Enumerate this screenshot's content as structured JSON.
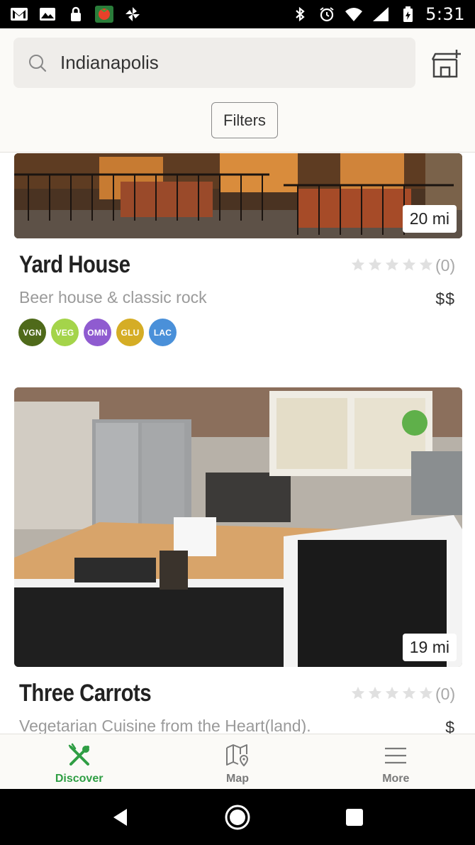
{
  "status_bar": {
    "time": "5:31"
  },
  "search": {
    "value": "Indianapolis",
    "placeholder": ""
  },
  "filters": {
    "label": "Filters"
  },
  "places": [
    {
      "name": "Yard House",
      "tagline": "Beer house & classic rock",
      "distance": "20 mi",
      "rating": 0,
      "review_count": "(0)",
      "price": "$$",
      "badges": [
        {
          "label": "VGN",
          "color": "#4f6a1a"
        },
        {
          "label": "VEG",
          "color": "#a4d44a"
        },
        {
          "label": "OMN",
          "color": "#8f5bd0"
        },
        {
          "label": "GLU",
          "color": "#d5ad25"
        },
        {
          "label": "LAC",
          "color": "#4a90d9"
        }
      ]
    },
    {
      "name": "Three Carrots",
      "tagline": "Vegetarian Cuisine from the Heart(land).",
      "distance": "19 mi",
      "rating": 0,
      "review_count": "(0)",
      "price": "$"
    }
  ],
  "bottom_nav": [
    {
      "label": "Discover",
      "icon": "fork-spoon-icon",
      "active": true
    },
    {
      "label": "Map",
      "icon": "map-pin-icon",
      "active": false
    },
    {
      "label": "More",
      "icon": "menu-icon",
      "active": false
    }
  ],
  "colors": {
    "accent": "#2f9e44",
    "inactive": "#7a7a7a",
    "star": "#e0e0e0"
  }
}
